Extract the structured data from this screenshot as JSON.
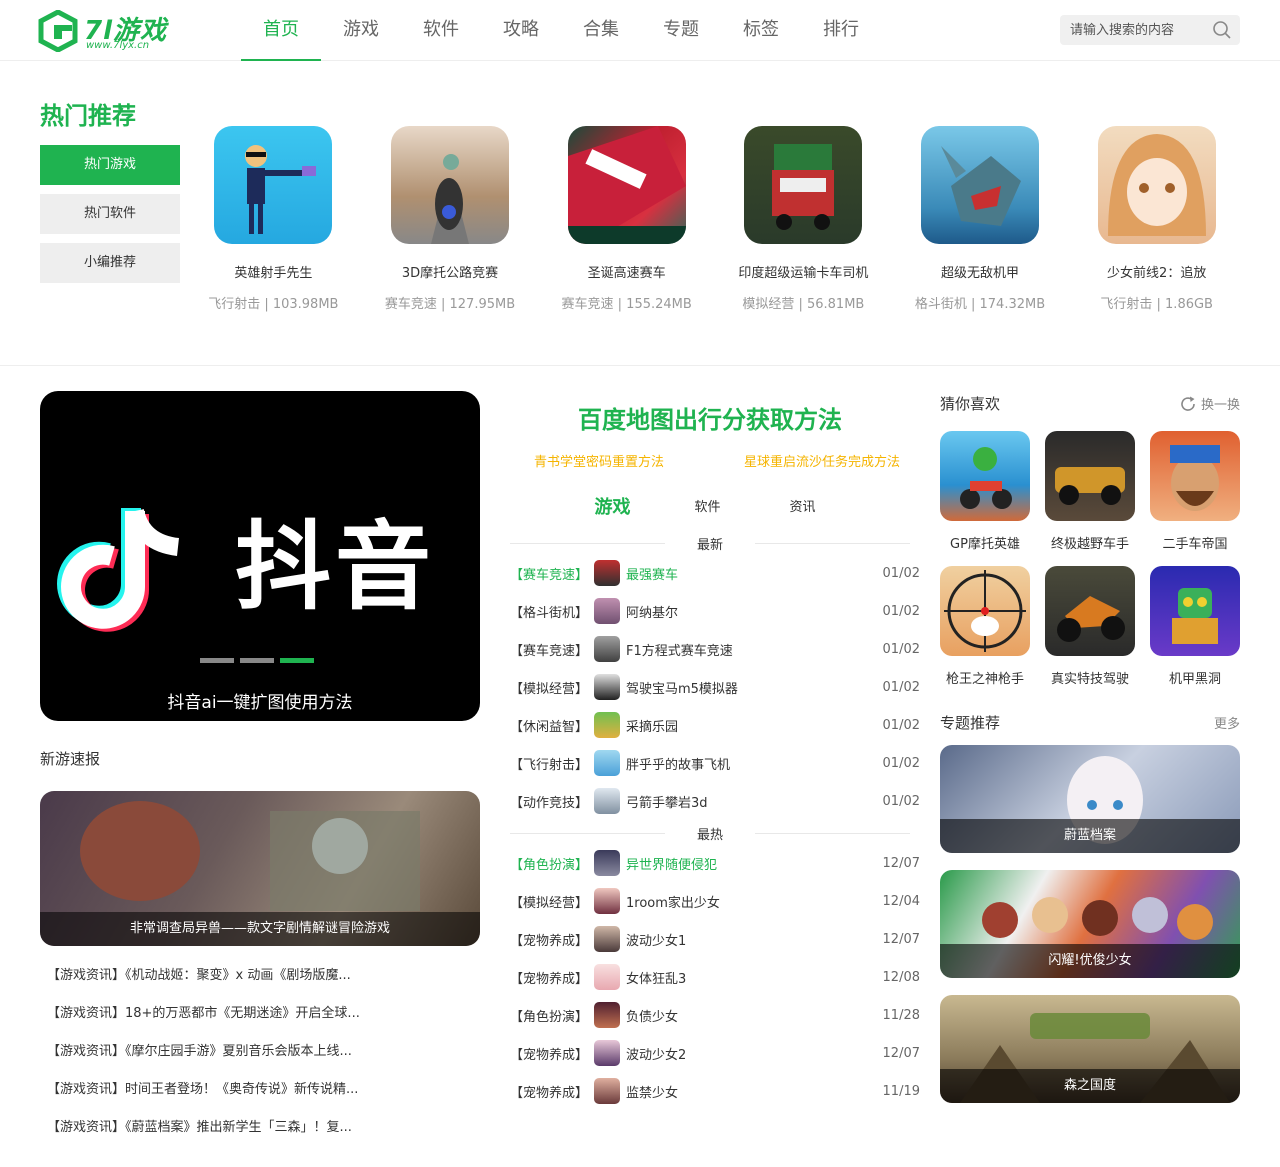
{
  "header": {
    "logo_text": "7l游戏",
    "logo_sub": "www.7lyx.cn",
    "nav": [
      "首页",
      "游戏",
      "软件",
      "攻略",
      "合集",
      "专题",
      "标签",
      "排行"
    ],
    "search_placeholder": "请输入搜索的内容"
  },
  "hot": {
    "title": "热门推荐",
    "tabs": [
      "热门游戏",
      "热门软件",
      "小编推荐"
    ],
    "items": [
      {
        "name": "英雄射手先生",
        "meta": "飞行射击 | 103.98MB"
      },
      {
        "name": "3D摩托公路竞赛",
        "meta": "赛车竞速 | 127.95MB"
      },
      {
        "name": "圣诞高速赛车",
        "meta": "赛车竞速 | 155.24MB"
      },
      {
        "name": "印度超级运输卡车司机",
        "meta": "模拟经营 | 56.81MB"
      },
      {
        "name": "超级无敌机甲",
        "meta": "格斗街机 | 174.32MB"
      },
      {
        "name": "少女前线2：追放",
        "meta": "飞行射击 | 1.86GB"
      }
    ]
  },
  "banner": {
    "brand": "抖音",
    "caption": "抖音ai一键扩图使用方法"
  },
  "new_games": {
    "title": "新游速报",
    "card_caption": "非常调查局异兽——款文字剧情解谜冒险游戏",
    "news": [
      "【游戏资讯】《机动战姬：聚变》x 动画《剧场版魔...",
      "【游戏资讯】18+的万恶都市《无期迷途》开启全球...",
      "【游戏资讯】《摩尔庄园手游》夏别音乐会版本上线...",
      "【游戏资讯】时间王者登场！《奥奇传说》新传说精...",
      "【游戏资讯】《蔚蓝档案》推出新学生「三森」！复..."
    ]
  },
  "center": {
    "headline": "百度地图出行分获取方法",
    "subheads": [
      "青书学堂密码重置方法",
      "星球重启流沙任务完成方法"
    ],
    "tabs": [
      "游戏",
      "软件",
      "资讯"
    ],
    "latest_label": "最新",
    "hot_label": "最热",
    "latest": [
      {
        "cat": "【赛车竞速】",
        "name": "最强赛车",
        "date": "01/02"
      },
      {
        "cat": "【格斗街机】",
        "name": "阿纳基尔",
        "date": "01/02"
      },
      {
        "cat": "【赛车竞速】",
        "name": "F1方程式赛车竞速",
        "date": "01/02"
      },
      {
        "cat": "【模拟经营】",
        "name": "驾驶宝马m5模拟器",
        "date": "01/02"
      },
      {
        "cat": "【休闲益智】",
        "name": "采摘乐园",
        "date": "01/02"
      },
      {
        "cat": "【飞行射击】",
        "name": "胖乎乎的故事飞机",
        "date": "01/02"
      },
      {
        "cat": "【动作竞技】",
        "name": "弓箭手攀岩3d",
        "date": "01/02"
      }
    ],
    "hottest": [
      {
        "cat": "【角色扮演】",
        "name": "异世界随便侵犯",
        "date": "12/07"
      },
      {
        "cat": "【模拟经营】",
        "name": "1room家出少女",
        "date": "12/04"
      },
      {
        "cat": "【宠物养成】",
        "name": "波动少女1",
        "date": "12/07"
      },
      {
        "cat": "【宠物养成】",
        "name": "女体狂乱3",
        "date": "12/08"
      },
      {
        "cat": "【角色扮演】",
        "name": "负债少女",
        "date": "11/28"
      },
      {
        "cat": "【宠物养成】",
        "name": "波动少女2",
        "date": "12/07"
      },
      {
        "cat": "【宠物养成】",
        "name": "监禁少女",
        "date": "11/19"
      }
    ]
  },
  "guess": {
    "title": "猜你喜欢",
    "refresh": "换一换",
    "items": [
      "GP摩托英雄",
      "终极越野车手",
      "二手车帝国",
      "枪王之神枪手",
      "真实特技驾驶",
      "机甲黑洞"
    ]
  },
  "topics": {
    "title": "专题推荐",
    "more": "更多",
    "items": [
      "蔚蓝档案",
      "闪耀!优俊少女",
      "森之国度"
    ]
  },
  "colors": {
    "accent": "#1fb350",
    "gold": "#f5b400"
  }
}
